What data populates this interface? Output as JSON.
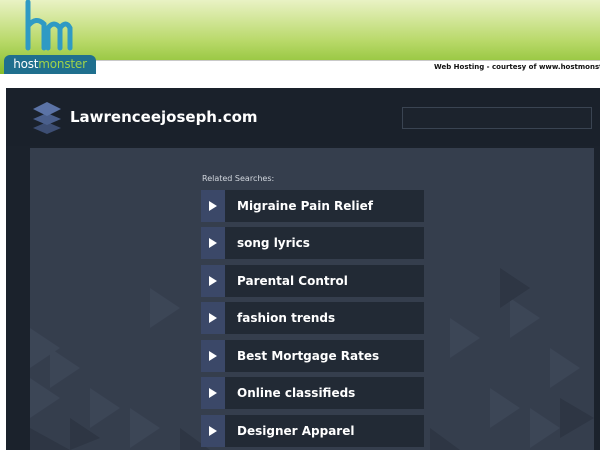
{
  "banner": {
    "logo_part1": "host",
    "logo_part2": "monster",
    "courtesy_text": "Web Hosting - courtesy of www.hostmonster.c"
  },
  "site": {
    "title": "Lawrenceejoseph.com"
  },
  "related": {
    "label": "Related Searches:",
    "links": [
      {
        "label": "Migraine Pain Relief"
      },
      {
        "label": "song lyrics"
      },
      {
        "label": "Parental Control"
      },
      {
        "label": "fashion trends"
      },
      {
        "label": "Best Mortgage Rates"
      },
      {
        "label": "Online classifieds"
      },
      {
        "label": "Designer Apparel"
      }
    ]
  },
  "colors": {
    "banner_green": "#86bd2a",
    "brand_blue": "#1f6f8e",
    "panel_dark": "#1b222c",
    "content_bg": "#353e4d",
    "link_bg": "#222a35",
    "arrow_bg": "#3b4868"
  }
}
